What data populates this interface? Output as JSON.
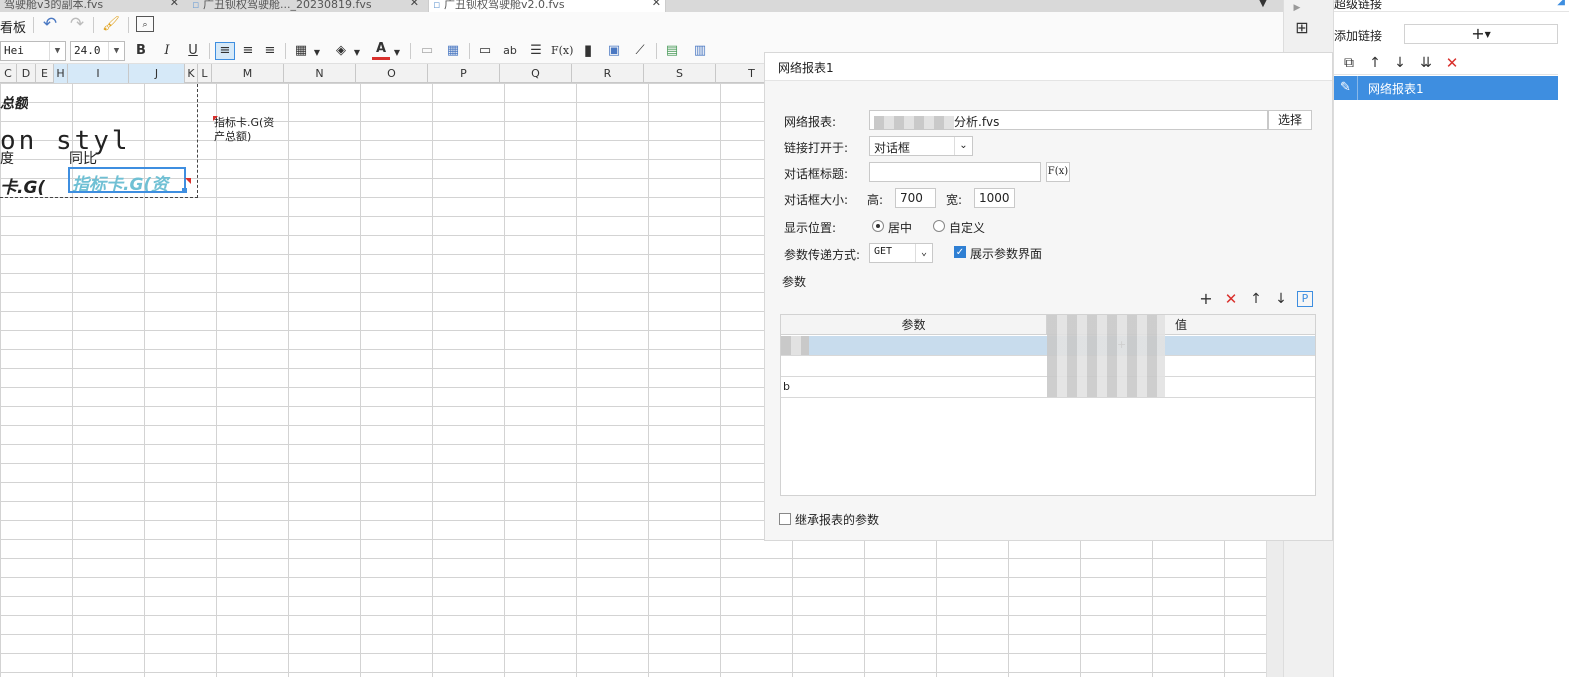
{
  "tabs": [
    {
      "label": "驾驶舱v3的副本.fvs",
      "active": false
    },
    {
      "label": "广丑钡权驾驶舱..._20230819.fvs",
      "active": false
    },
    {
      "label": "广丑钡权驾驶舱v2.0.fvs",
      "active": true
    }
  ],
  "toolbar": {
    "left_label": "看板",
    "font_name": "Hei",
    "font_size": "24.0",
    "bold": "B",
    "italic": "I",
    "underline": "U",
    "text_ab": "ab",
    "formula": "F(x)"
  },
  "columns": [
    {
      "label": "C",
      "selected": false
    },
    {
      "label": "D",
      "selected": false
    },
    {
      "label": "E",
      "selected": false
    },
    {
      "label": "H",
      "selected": true
    },
    {
      "label": "I",
      "selected": true
    },
    {
      "label": "J",
      "selected": true
    },
    {
      "label": "K",
      "selected": false
    },
    {
      "label": "L",
      "selected": false
    },
    {
      "label": "M",
      "selected": false
    },
    {
      "label": "N",
      "selected": false
    },
    {
      "label": "O",
      "selected": false
    },
    {
      "label": "P",
      "selected": false
    },
    {
      "label": "Q",
      "selected": false
    },
    {
      "label": "R",
      "selected": false
    },
    {
      "label": "S",
      "selected": false
    },
    {
      "label": "T",
      "selected": false
    }
  ],
  "cells": {
    "total": "总额",
    "style_text": "on style",
    "degree": "度",
    "yoy": "同比",
    "card_left": "卡.G(",
    "card_sel": "指标卡.G(资",
    "note": "指标卡.G(资产总额)"
  },
  "dialog": {
    "title": "网络报表1",
    "report_label": "网络报表:",
    "report_value": "分析.fvs",
    "choose_btn": "选择",
    "open_in_label": "链接打开于:",
    "open_in_value": "对话框",
    "dlg_title_label": "对话框标题:",
    "dlg_title_value": "",
    "fx_btn": "F(x)",
    "size_label": "对话框大小:",
    "height_label": "高:",
    "height_value": "700",
    "width_label": "宽:",
    "width_value": "1000",
    "position_label": "显示位置:",
    "position_center": "居中",
    "position_custom": "自定义",
    "param_method_label": "参数传递方式:",
    "param_method_value": "GET",
    "show_param_ui": "展示参数界面",
    "params_title": "参数",
    "col_param": "参数",
    "col_value": "值",
    "row_values": [
      "+",
      "",
      ""
    ],
    "row_marks": [
      "",
      "",
      "b"
    ],
    "inherit_label": "继承报表的参数"
  },
  "hyperlink_panel": {
    "title": "超级链接",
    "add_label": "添加链接",
    "items": [
      {
        "label": "网络报表1",
        "selected": true
      }
    ]
  },
  "colors": {
    "accent": "#2f7fd3",
    "selection": "#3e8ee0",
    "danger": "#d9302c",
    "card_text": "#6fc0d4"
  }
}
